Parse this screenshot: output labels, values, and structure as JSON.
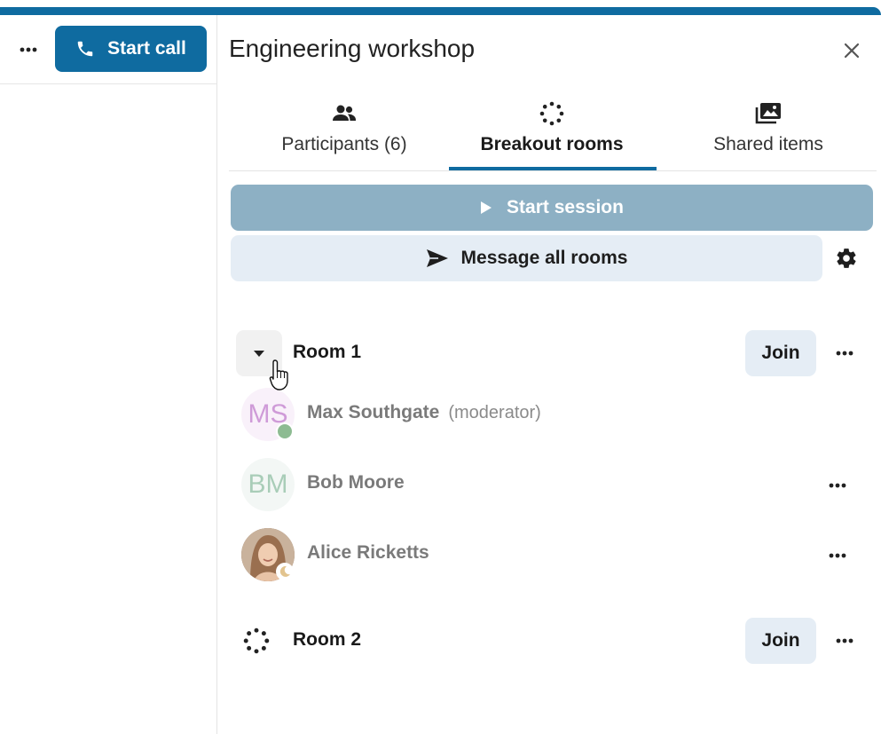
{
  "left": {
    "start_call_label": "Start call"
  },
  "panel": {
    "title": "Engineering workshop",
    "tabs": [
      {
        "label": "Participants (6)",
        "icon": "people-icon"
      },
      {
        "label": "Breakout rooms",
        "icon": "breakout-rooms-icon",
        "active": true
      },
      {
        "label": "Shared items",
        "icon": "images-icon"
      }
    ],
    "start_session_label": "Start session",
    "message_all_label": "Message all rooms",
    "rooms": [
      {
        "name": "Room 1",
        "join_label": "Join",
        "expanded": true,
        "participants": [
          {
            "initials": "MS",
            "name": "Max Southgate",
            "role": "(moderator)",
            "status": "online"
          },
          {
            "initials": "BM",
            "name": "Bob Moore",
            "role": "",
            "status": ""
          },
          {
            "initials": "",
            "name": "Alice Ricketts",
            "role": "",
            "status": "away"
          }
        ]
      },
      {
        "name": "Room 2",
        "join_label": "Join",
        "expanded": false
      }
    ]
  },
  "colors": {
    "primary": "#0f6ba0",
    "start_session_bg": "#8db0c4",
    "secondary_button_bg": "#e5edf5",
    "online": "#8dbb92"
  }
}
